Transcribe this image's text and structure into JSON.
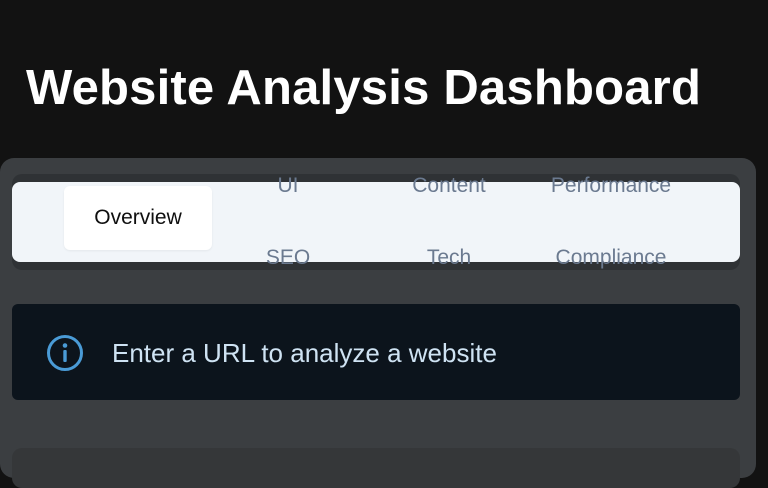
{
  "header": {
    "title": "Website Analysis Dashboard"
  },
  "tabs": [
    {
      "label": "Overview",
      "active": true
    },
    {
      "label": "UI",
      "active": false
    },
    {
      "label": "Content",
      "active": false
    },
    {
      "label": "Performance",
      "active": false
    },
    {
      "label": "SEO",
      "active": false
    },
    {
      "label": "Tech",
      "active": false
    },
    {
      "label": "Compliance",
      "active": false
    }
  ],
  "alert": {
    "icon": "info-icon",
    "message": "Enter a URL to analyze a website"
  },
  "colors": {
    "page_background": "#121212",
    "panel_background": "#3b3e41",
    "tab_list_background": "#f1f5f9",
    "inactive_tab_text": "#6b7a90",
    "alert_background": "#0c141c",
    "alert_icon": "#4a9bd6",
    "alert_text": "#cfe3f3"
  }
}
